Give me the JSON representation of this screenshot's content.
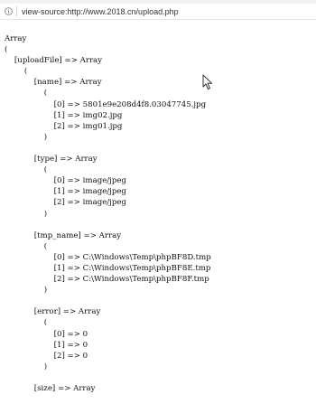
{
  "browser": {
    "url": "view-source:http://www.2018.cn/upload.php",
    "info_icon": "info-circle-icon",
    "cursor_icon": "mouse-pointer-icon"
  },
  "source": {
    "text": "Array\n(\n    [uploadFile] => Array\n        (\n            [name] => Array\n                (\n                    [0] => 5801e9e208d4f8.03047745.jpg\n                    [1] => img02.jpg\n                    [2] => img01.jpg\n                )\n\n            [type] => Array\n                (\n                    [0] => image/jpeg\n                    [1] => image/jpeg\n                    [2] => image/jpeg\n                )\n\n            [tmp_name] => Array\n                (\n                    [0] => C:\\Windows\\Temp\\phpBF8D.tmp\n                    [1] => C:\\Windows\\Temp\\phpBF8E.tmp\n                    [2] => C:\\Windows\\Temp\\phpBF8F.tmp\n                )\n\n            [error] => Array\n                (\n                    [0] => 0\n                    [1] => 0\n                    [2] => 0\n                )\n\n            [size] => Array"
  }
}
